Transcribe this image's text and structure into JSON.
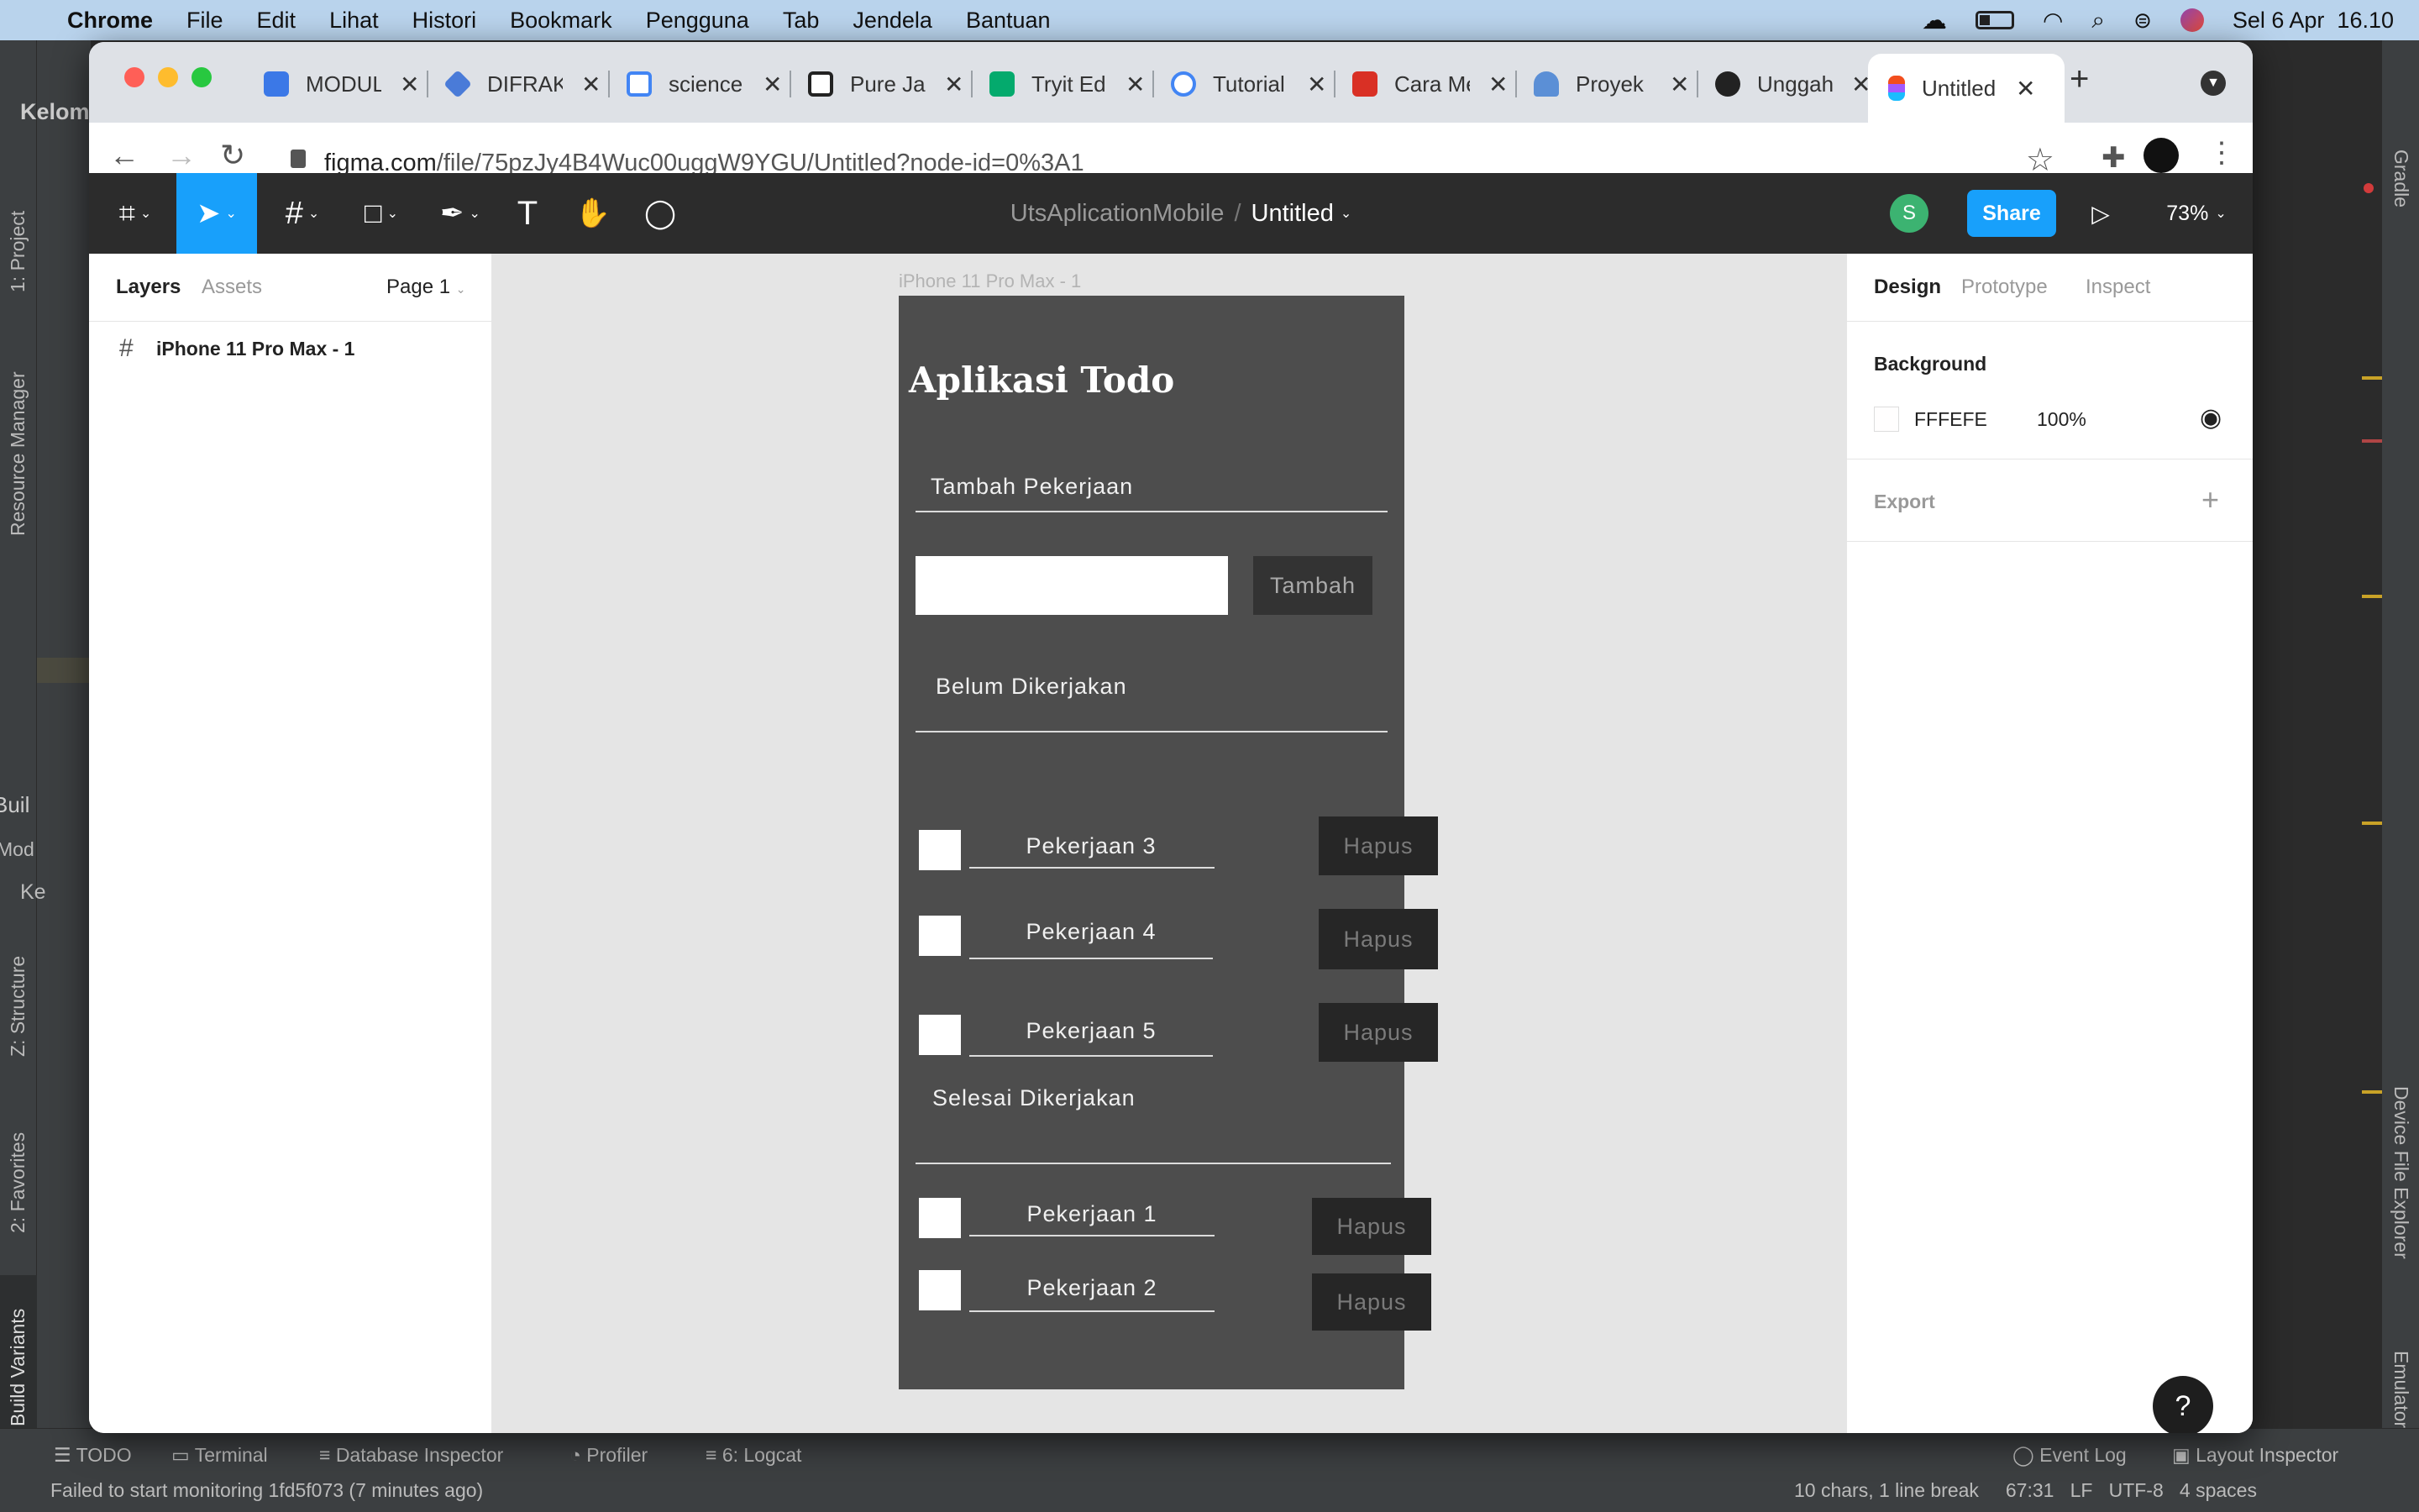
{
  "menubar": {
    "app": "Chrome",
    "items": [
      "File",
      "Edit",
      "Lihat",
      "Histori",
      "Bookmark",
      "Pengguna",
      "Tab",
      "Jendela",
      "Bantuan"
    ],
    "datetime": "Sel 6 Apr  16.10"
  },
  "ide": {
    "project_label": "Kelom",
    "vtabs_left": [
      "1: Project",
      "Resource Manager",
      "Z: Structure",
      "2: Favorites",
      "Build Variants"
    ],
    "vtabs_right": [
      "Gradle",
      "Device File Explorer",
      "Emulator"
    ],
    "build_label": "Buil",
    "mod_label": "Mod",
    "ke_label": "Ke",
    "bottom_tabs": [
      "TODO",
      "Terminal",
      "Database Inspector",
      "Profiler",
      "6: Logcat"
    ],
    "bottom_right_tabs": [
      "Event Log",
      "Layout Inspector"
    ],
    "status_message": "Failed to start monitoring 1fd5f073 (7 minutes ago)",
    "status_right": "10 chars, 1 line break     67:31   LF   UTF-8   4 spaces"
  },
  "browser": {
    "tabs": [
      "MODUL",
      "DIFRAK",
      "science",
      "Pure Ja",
      "Tryit Ed",
      "Tutorial",
      "Cara Me",
      "Proyek",
      "Unggah",
      "Untitled"
    ],
    "url_domain": "figma.com",
    "url_path": "/file/75pzJy4B4Wuc00uggW9YGU/Untitled?node-id=0%3A1"
  },
  "figma": {
    "project": "UtsAplicationMobile",
    "separator": "/",
    "file": "Untitled",
    "avatar": "S",
    "share": "Share",
    "zoom": "73%",
    "left_tabs": [
      "Layers",
      "Assets"
    ],
    "page": "Page 1",
    "layer": "iPhone 11 Pro Max - 1",
    "frame_label": "iPhone 11 Pro Max - 1",
    "right_tabs": [
      "Design",
      "Prototype",
      "Inspect"
    ],
    "background_label": "Background",
    "bg_hex": "FFFEFE",
    "bg_opacity": "100%",
    "export_label": "Export",
    "help": "?",
    "accent": "#18a0fb"
  },
  "app": {
    "title": "Aplikasi Todo",
    "section_add": "Tambah Pekerjaan",
    "add_button": "Tambah",
    "section_pending": "Belum Dikerjakan",
    "pending": [
      "Pekerjaan 3",
      "Pekerjaan 4",
      "Pekerjaan 5"
    ],
    "section_done": "Selesai Dikerjakan",
    "done": [
      "Pekerjaan 1",
      "Pekerjaan 2"
    ],
    "delete_label": "Hapus"
  }
}
